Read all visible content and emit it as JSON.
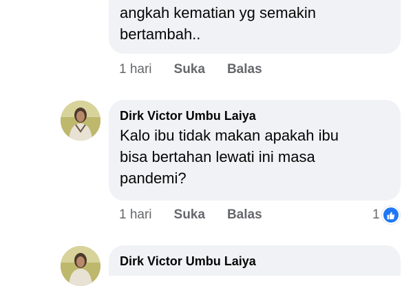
{
  "colors": {
    "bubble_bg": "#f0f2f5",
    "meta_text": "#65676b",
    "like_blue": "#2078f4"
  },
  "comment1": {
    "lines": [
      "angkah kematian yg semakin",
      "bertambah.."
    ],
    "time": "1 hari",
    "like_label": "Suka",
    "reply_label": "Balas"
  },
  "comment2": {
    "author": "Dirk Victor Umbu Laiya",
    "avatar_icon": "user-photo",
    "lines": [
      "Kalo ibu tidak makan apakah ibu",
      "bisa bertahan lewati ini masa",
      "pandemi?"
    ],
    "time": "1 hari",
    "like_label": "Suka",
    "reply_label": "Balas",
    "reaction_count": "1",
    "reaction_icon": "like-thumb-icon"
  },
  "comment3": {
    "author": "Dirk Victor Umbu Laiya",
    "avatar_icon": "user-photo"
  }
}
